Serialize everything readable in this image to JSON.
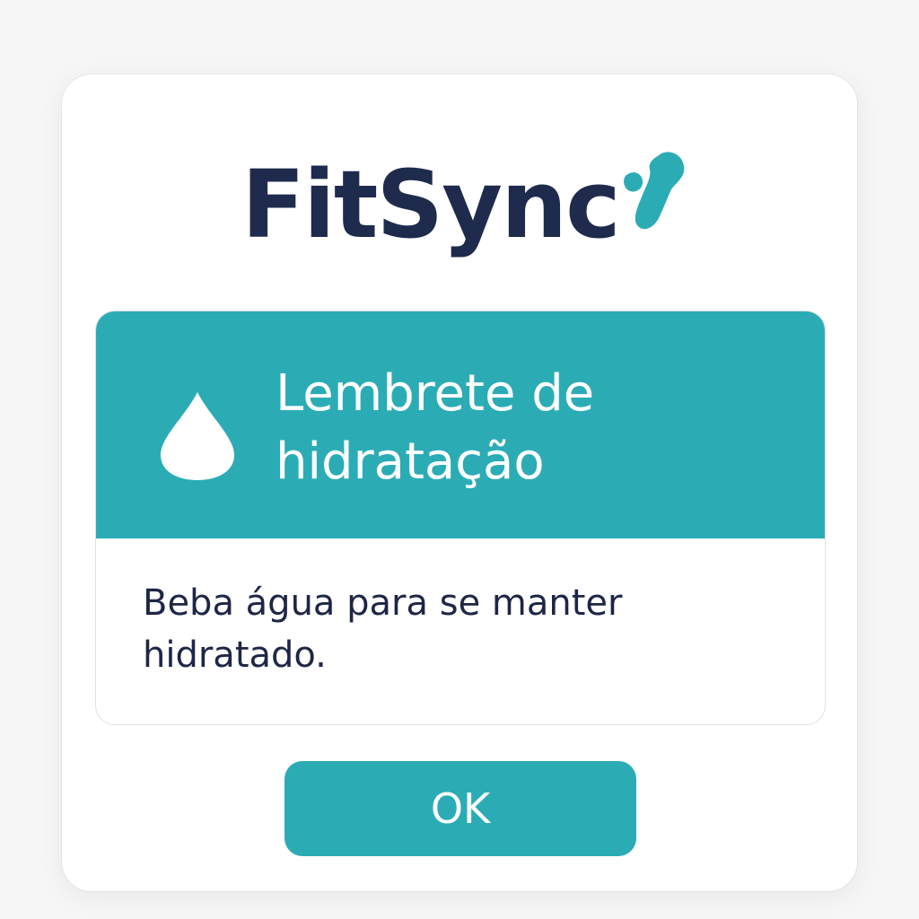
{
  "app": {
    "logo_text": "FitSync"
  },
  "dialog": {
    "title": "Lembrete de hidratação",
    "message": "Beba água para se manter hidratado.",
    "ok_label": "OK",
    "icon": "water-drop-icon"
  },
  "colors": {
    "accent": "#2bacb5",
    "brand_text": "#1e2b4d",
    "body_text": "#1e2646"
  }
}
